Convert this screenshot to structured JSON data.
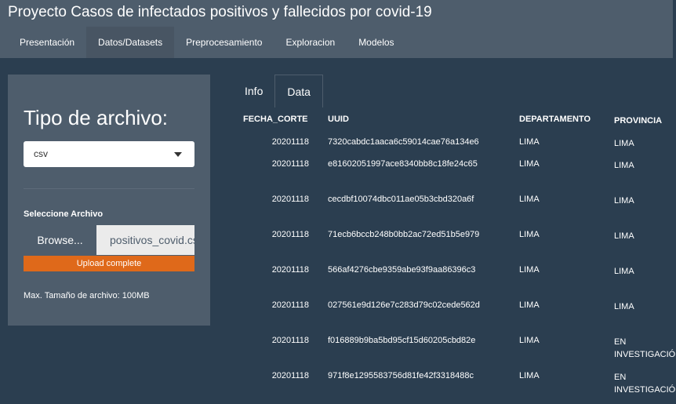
{
  "app": {
    "title": "Proyecto Casos de infectados positivos y fallecidos por covid-19"
  },
  "nav": {
    "tabs": [
      {
        "label": "Presentación",
        "active": false
      },
      {
        "label": "Datos/Datasets",
        "active": true
      },
      {
        "label": "Preprocesamiento",
        "active": false
      },
      {
        "label": "Exploracion",
        "active": false
      },
      {
        "label": "Modelos",
        "active": false
      }
    ]
  },
  "sidebar": {
    "heading": "Tipo de archivo:",
    "select_value": "csv",
    "file_label": "Seleccione Archivo",
    "browse_label": "Browse...",
    "file_name": "positivos_covid.csv",
    "progress_text": "Upload complete",
    "progress_fraction": 1.0,
    "max_size": "Max. Tamaño de archivo: 100MB"
  },
  "content": {
    "tabs": [
      {
        "label": "Info",
        "active": false
      },
      {
        "label": "Data",
        "active": true
      }
    ]
  },
  "table": {
    "headers": [
      "FECHA_CORTE",
      "UUID",
      "DEPARTAMENTO",
      "PROVINCIA"
    ],
    "rows": [
      [
        "20201118",
        "7320cabdc1aaca6c59014cae76a134e6",
        "LIMA",
        "LIMA"
      ],
      [
        "20201118",
        "e81602051997ace8340bb8c18fe24c65",
        "LIMA",
        "LIMA"
      ],
      [
        "20201118",
        "cecdbf10074dbc011ae05b3cbd320a6f",
        "LIMA",
        "LIMA"
      ],
      [
        "20201118",
        "71ecb6bccb248b0bb2ac72ed51b5e979",
        "LIMA",
        "LIMA"
      ],
      [
        "20201118",
        "566af4276cbe9359abe93f9aa86396c3",
        "LIMA",
        "LIMA"
      ],
      [
        "20201118",
        "027561e9d126e7c283d79c02cede562d",
        "LIMA",
        "LIMA"
      ],
      [
        "20201118",
        "f016889b9ba5bd95cf15d60205cbd82e",
        "LIMA",
        "EN INVESTIGACIÓN"
      ],
      [
        "20201118",
        "971f8e1295583756d81fe42f3318488c",
        "LIMA",
        "EN INVESTIGACIÓN"
      ]
    ]
  },
  "colors": {
    "background": "#2b3e50",
    "panel": "#4e5d6c",
    "accent": "#df691a"
  }
}
